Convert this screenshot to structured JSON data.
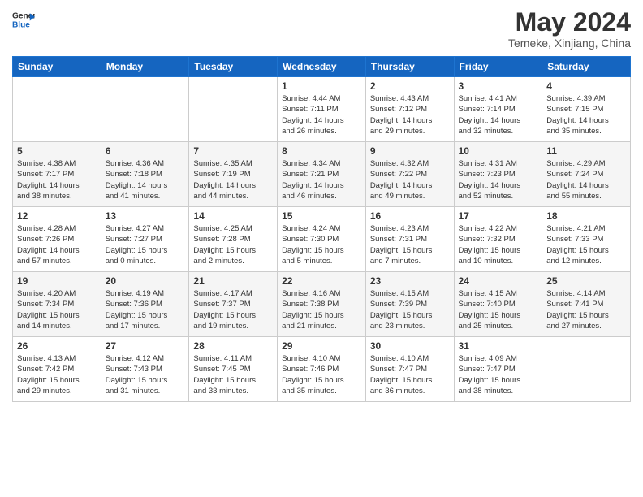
{
  "logo": {
    "line1": "General",
    "line2": "Blue"
  },
  "title": "May 2024",
  "location": "Temeke, Xinjiang, China",
  "headers": [
    "Sunday",
    "Monday",
    "Tuesday",
    "Wednesday",
    "Thursday",
    "Friday",
    "Saturday"
  ],
  "weeks": [
    [
      {
        "day": "",
        "info": ""
      },
      {
        "day": "",
        "info": ""
      },
      {
        "day": "",
        "info": ""
      },
      {
        "day": "1",
        "info": "Sunrise: 4:44 AM\nSunset: 7:11 PM\nDaylight: 14 hours\nand 26 minutes."
      },
      {
        "day": "2",
        "info": "Sunrise: 4:43 AM\nSunset: 7:12 PM\nDaylight: 14 hours\nand 29 minutes."
      },
      {
        "day": "3",
        "info": "Sunrise: 4:41 AM\nSunset: 7:14 PM\nDaylight: 14 hours\nand 32 minutes."
      },
      {
        "day": "4",
        "info": "Sunrise: 4:39 AM\nSunset: 7:15 PM\nDaylight: 14 hours\nand 35 minutes."
      }
    ],
    [
      {
        "day": "5",
        "info": "Sunrise: 4:38 AM\nSunset: 7:17 PM\nDaylight: 14 hours\nand 38 minutes."
      },
      {
        "day": "6",
        "info": "Sunrise: 4:36 AM\nSunset: 7:18 PM\nDaylight: 14 hours\nand 41 minutes."
      },
      {
        "day": "7",
        "info": "Sunrise: 4:35 AM\nSunset: 7:19 PM\nDaylight: 14 hours\nand 44 minutes."
      },
      {
        "day": "8",
        "info": "Sunrise: 4:34 AM\nSunset: 7:21 PM\nDaylight: 14 hours\nand 46 minutes."
      },
      {
        "day": "9",
        "info": "Sunrise: 4:32 AM\nSunset: 7:22 PM\nDaylight: 14 hours\nand 49 minutes."
      },
      {
        "day": "10",
        "info": "Sunrise: 4:31 AM\nSunset: 7:23 PM\nDaylight: 14 hours\nand 52 minutes."
      },
      {
        "day": "11",
        "info": "Sunrise: 4:29 AM\nSunset: 7:24 PM\nDaylight: 14 hours\nand 55 minutes."
      }
    ],
    [
      {
        "day": "12",
        "info": "Sunrise: 4:28 AM\nSunset: 7:26 PM\nDaylight: 14 hours\nand 57 minutes."
      },
      {
        "day": "13",
        "info": "Sunrise: 4:27 AM\nSunset: 7:27 PM\nDaylight: 15 hours\nand 0 minutes."
      },
      {
        "day": "14",
        "info": "Sunrise: 4:25 AM\nSunset: 7:28 PM\nDaylight: 15 hours\nand 2 minutes."
      },
      {
        "day": "15",
        "info": "Sunrise: 4:24 AM\nSunset: 7:30 PM\nDaylight: 15 hours\nand 5 minutes."
      },
      {
        "day": "16",
        "info": "Sunrise: 4:23 AM\nSunset: 7:31 PM\nDaylight: 15 hours\nand 7 minutes."
      },
      {
        "day": "17",
        "info": "Sunrise: 4:22 AM\nSunset: 7:32 PM\nDaylight: 15 hours\nand 10 minutes."
      },
      {
        "day": "18",
        "info": "Sunrise: 4:21 AM\nSunset: 7:33 PM\nDaylight: 15 hours\nand 12 minutes."
      }
    ],
    [
      {
        "day": "19",
        "info": "Sunrise: 4:20 AM\nSunset: 7:34 PM\nDaylight: 15 hours\nand 14 minutes."
      },
      {
        "day": "20",
        "info": "Sunrise: 4:19 AM\nSunset: 7:36 PM\nDaylight: 15 hours\nand 17 minutes."
      },
      {
        "day": "21",
        "info": "Sunrise: 4:17 AM\nSunset: 7:37 PM\nDaylight: 15 hours\nand 19 minutes."
      },
      {
        "day": "22",
        "info": "Sunrise: 4:16 AM\nSunset: 7:38 PM\nDaylight: 15 hours\nand 21 minutes."
      },
      {
        "day": "23",
        "info": "Sunrise: 4:15 AM\nSunset: 7:39 PM\nDaylight: 15 hours\nand 23 minutes."
      },
      {
        "day": "24",
        "info": "Sunrise: 4:15 AM\nSunset: 7:40 PM\nDaylight: 15 hours\nand 25 minutes."
      },
      {
        "day": "25",
        "info": "Sunrise: 4:14 AM\nSunset: 7:41 PM\nDaylight: 15 hours\nand 27 minutes."
      }
    ],
    [
      {
        "day": "26",
        "info": "Sunrise: 4:13 AM\nSunset: 7:42 PM\nDaylight: 15 hours\nand 29 minutes."
      },
      {
        "day": "27",
        "info": "Sunrise: 4:12 AM\nSunset: 7:43 PM\nDaylight: 15 hours\nand 31 minutes."
      },
      {
        "day": "28",
        "info": "Sunrise: 4:11 AM\nSunset: 7:45 PM\nDaylight: 15 hours\nand 33 minutes."
      },
      {
        "day": "29",
        "info": "Sunrise: 4:10 AM\nSunset: 7:46 PM\nDaylight: 15 hours\nand 35 minutes."
      },
      {
        "day": "30",
        "info": "Sunrise: 4:10 AM\nSunset: 7:47 PM\nDaylight: 15 hours\nand 36 minutes."
      },
      {
        "day": "31",
        "info": "Sunrise: 4:09 AM\nSunset: 7:47 PM\nDaylight: 15 hours\nand 38 minutes."
      },
      {
        "day": "",
        "info": ""
      }
    ]
  ]
}
